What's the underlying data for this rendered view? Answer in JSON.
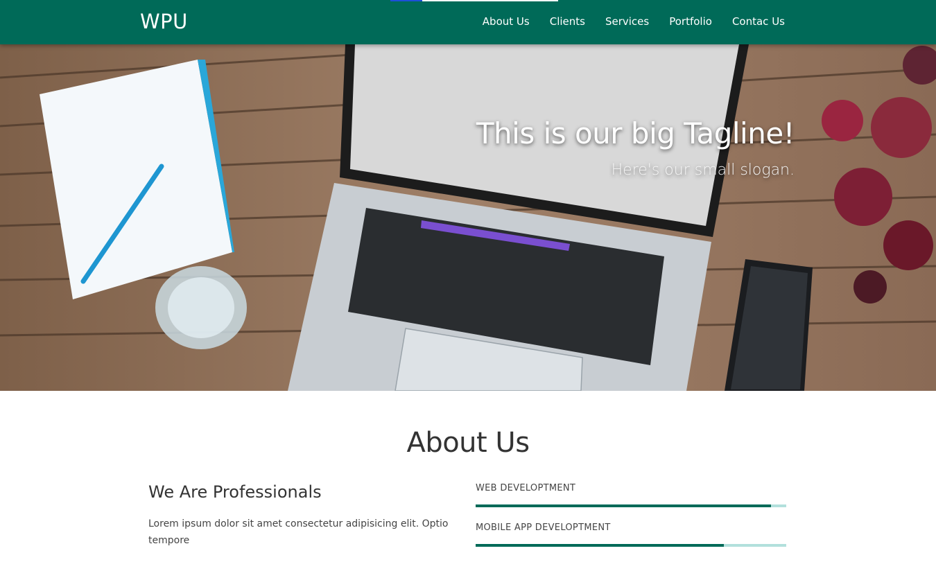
{
  "brand": "WPU",
  "nav": {
    "items": [
      "About Us",
      "Clients",
      "Services",
      "Portfolio",
      "Contac Us"
    ]
  },
  "hero": {
    "tagline": "This is our big Tagline!",
    "slogan": "Here's our small slogan."
  },
  "about": {
    "title": "About Us",
    "heading": "We Are Professionals",
    "text": "Lorem ipsum dolor sit amet consectetur adipisicing elit. Optio tempore",
    "skills": [
      {
        "label": "WEB DEVELOPTMENT",
        "level": 0.95
      },
      {
        "label": "MOBILE APP DEVELOPTMENT",
        "level": 0.8
      }
    ]
  },
  "colors": {
    "primary": "#006a58",
    "track": "#b2e0dc"
  },
  "icons": {
    "hero": "laptop-desk-photo"
  }
}
